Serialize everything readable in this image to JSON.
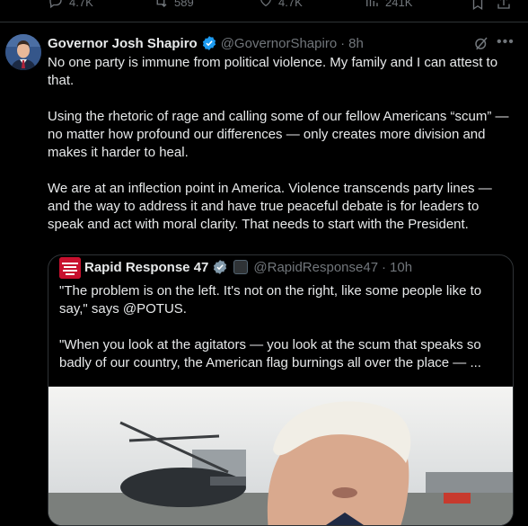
{
  "previous_tweet": {
    "actions": {
      "replies": "4.7K",
      "reposts": "589",
      "likes": "4.7K",
      "views": "241K"
    }
  },
  "tweet": {
    "author_name": "Governor Josh Shapiro",
    "handle": "@GovernorShapiro",
    "separator": "·",
    "time": "8h",
    "paragraphs": [
      "No one party is immune from political violence. My family and I can attest to that.",
      "Using the rhetoric of rage and calling some of our fellow Americans “scum” — no matter how profound our differences — only creates more division and makes it harder to heal.",
      "We are at an inflection point in America. Violence transcends party lines — and the way to address it and have true peaceful debate is for leaders to speak and act with moral clarity. That needs to start with the President."
    ]
  },
  "quoted_tweet": {
    "author_name": "Rapid Response 47",
    "handle": "@RapidResponse47",
    "separator": "·",
    "time": "10h",
    "paragraphs": [
      "\"The problem is on the left. It's not on the right, like some people like to say,\" says @POTUS.",
      "\"When you look at the agitators — you look at the scum that speaks so badly of our country, the American flag burnings all over the place — ..."
    ]
  },
  "icons": {
    "reply": "reply-icon",
    "repost": "repost-icon",
    "like": "heart-icon",
    "views": "views-icon",
    "bookmark": "bookmark-icon",
    "share": "share-icon",
    "verified": "verified-badge-icon",
    "grok": "grok-icon",
    "more": "more-icon"
  },
  "colors": {
    "background": "#000000",
    "text": "#e7e9ea",
    "muted": "#71767b",
    "border": "#2f3336",
    "verified_blue": "#1d9bf0",
    "rapid_response_red": "#c8102e"
  }
}
